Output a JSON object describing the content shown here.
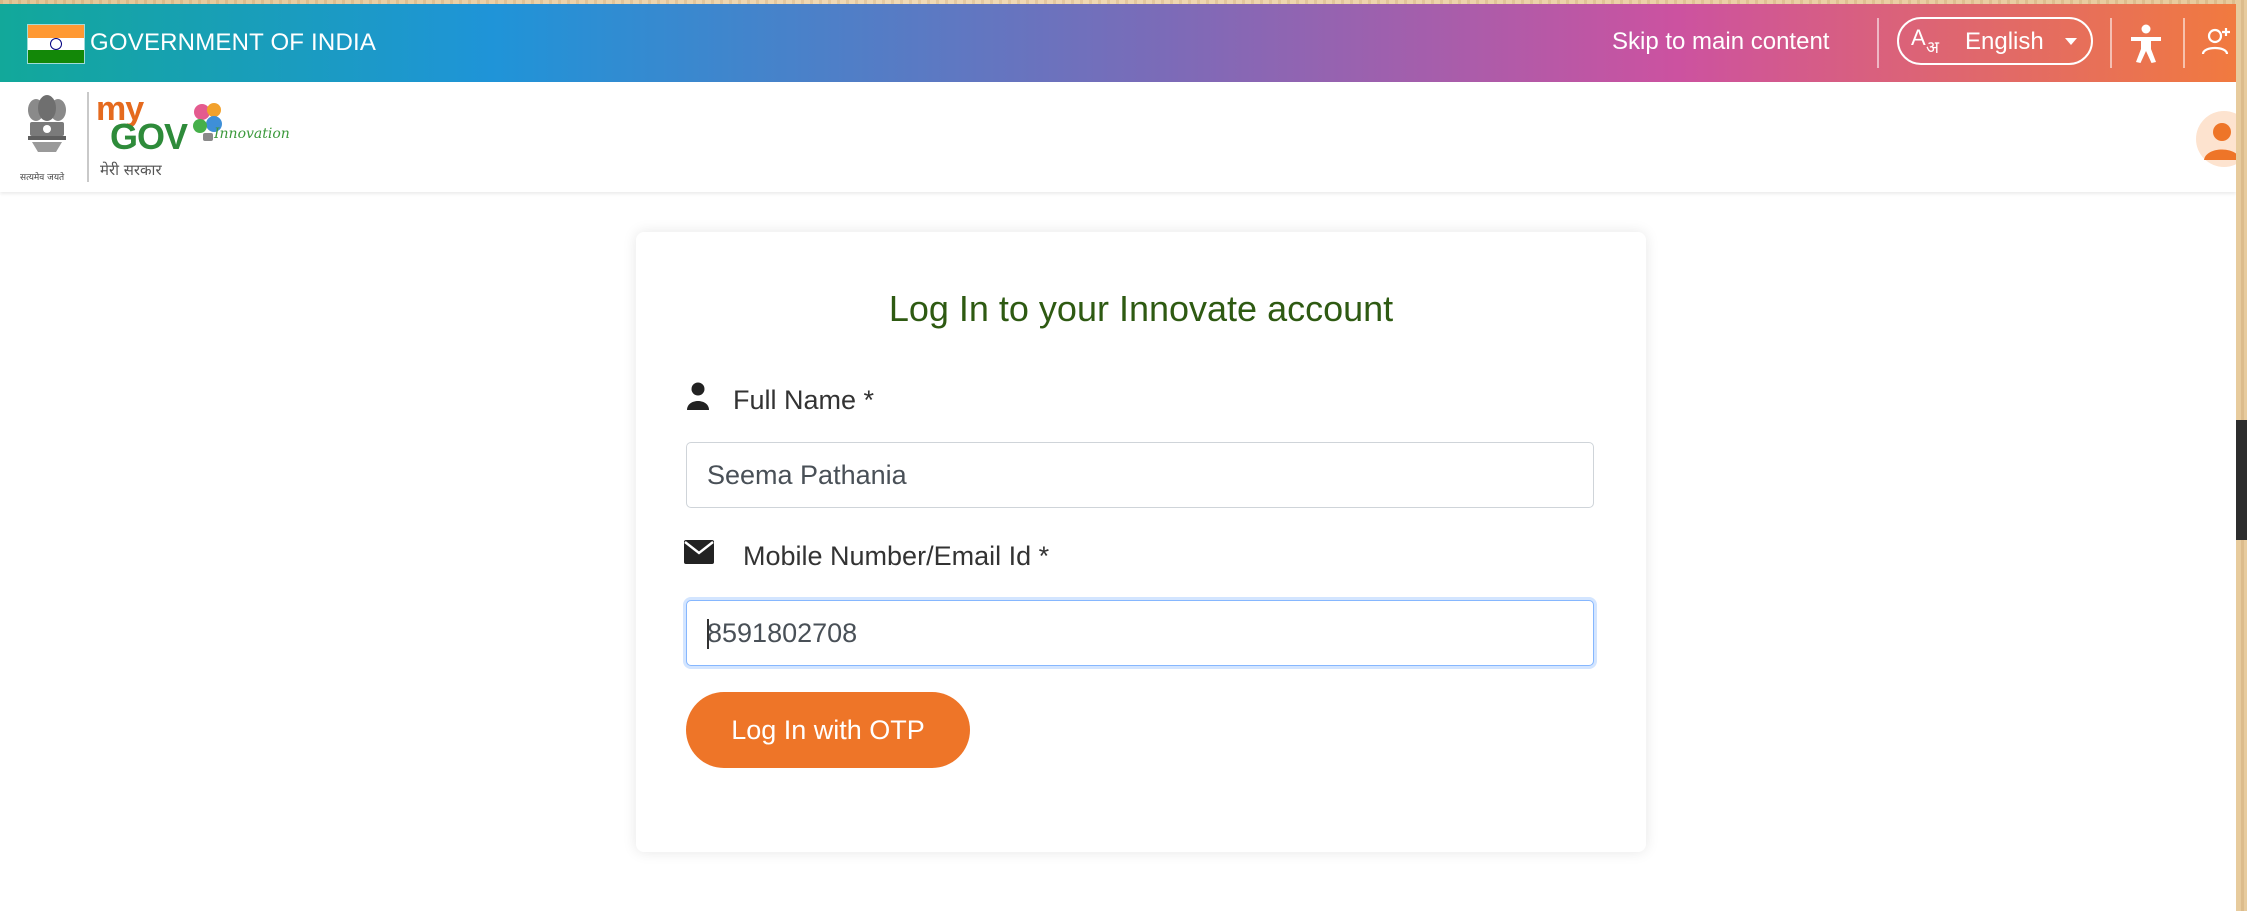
{
  "govbar": {
    "title": "GOVERNMENT OF INDIA",
    "skip_link": "Skip to main content",
    "language": "English",
    "language_glyph_latin": "A",
    "language_glyph_hindi": "अ",
    "accessibility_icon": "accessibility-icon",
    "user_plus_icon": "user-plus-icon"
  },
  "header": {
    "emblem_caption": "सत्यमेव जयते",
    "logo_my": "my",
    "logo_gov": "GOV",
    "logo_hindi": "मेरी सरकार",
    "logo_innovation": "Innovation",
    "avatar_icon": "user-avatar-icon"
  },
  "login": {
    "title": "Log In to your Innovate account",
    "fullname_label": "Full Name *",
    "fullname_value": "Seema Pathania",
    "contact_label": "Mobile Number/Email Id *",
    "contact_value": "8591802708",
    "submit_label": "Log In with OTP"
  },
  "colors": {
    "accent": "#ee7528",
    "title_green": "#2e5a12",
    "focus_blue": "#86b7fe"
  }
}
